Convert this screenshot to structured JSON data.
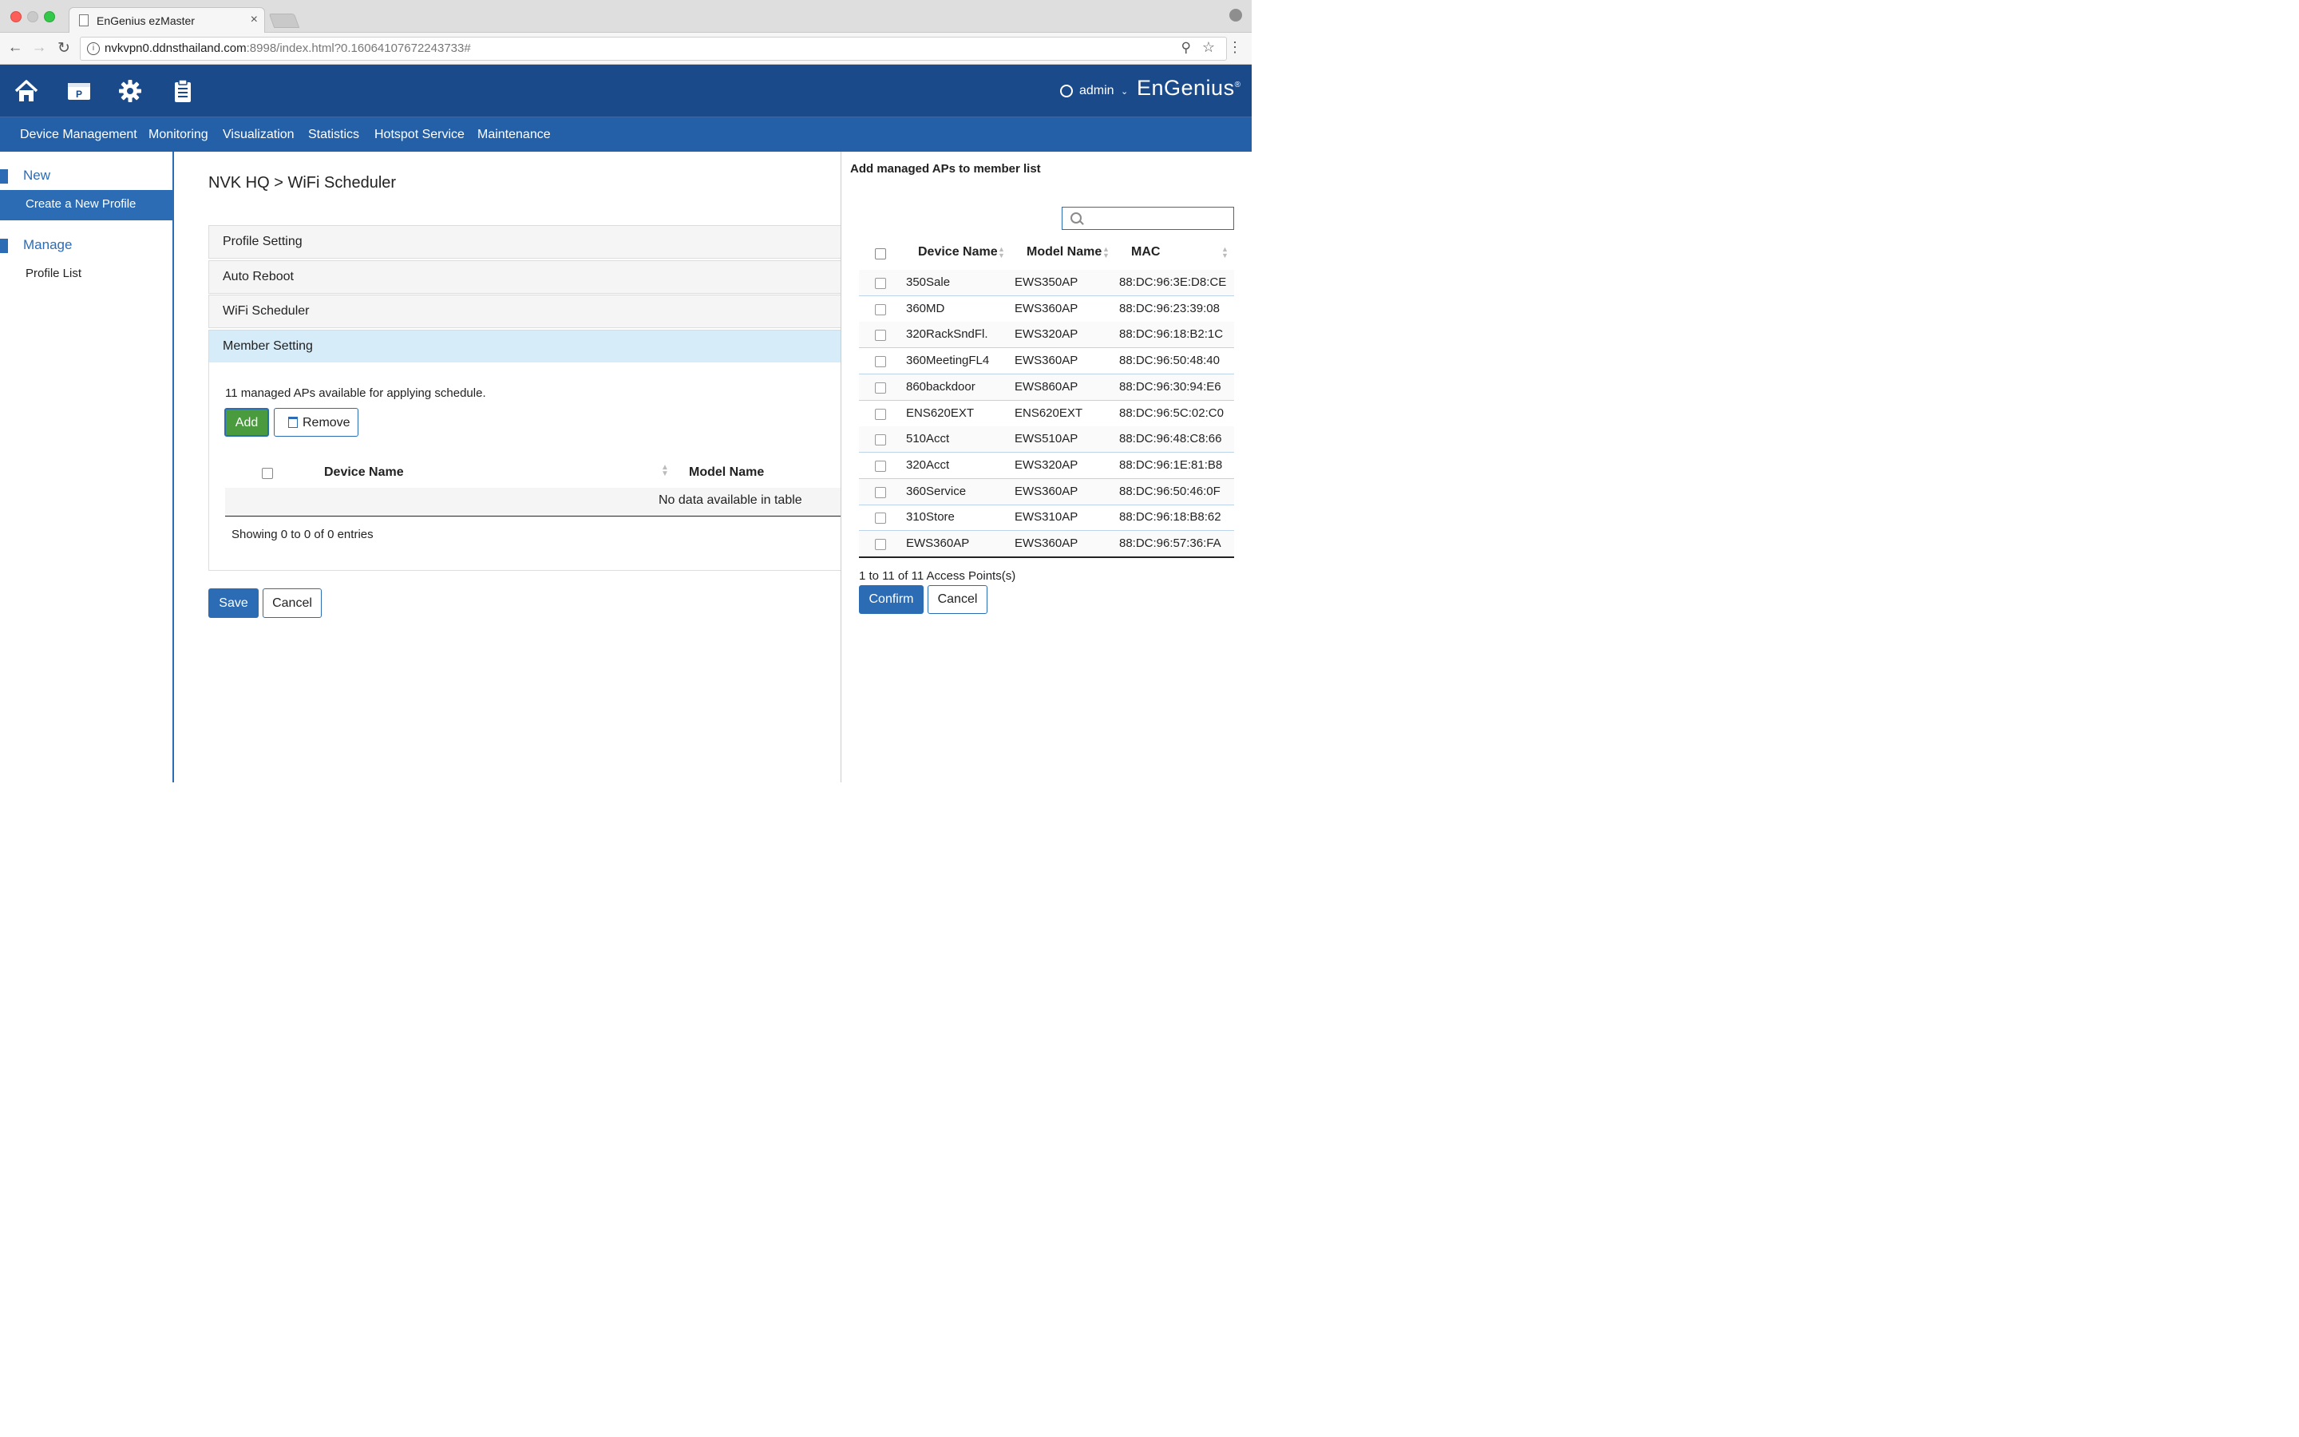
{
  "browser": {
    "tab_title": "EnGenius ezMaster",
    "tab_close": "×",
    "url_host": "nvkvpn0.ddnsthailand.com",
    "url_rest": ":8998/index.html?0.16064107672243733#"
  },
  "header": {
    "user": "admin",
    "brand": "EnGenius",
    "brand_mark": "®"
  },
  "nav": [
    "Device Management",
    "Monitoring",
    "Visualization",
    "Statistics",
    "Hotspot Service",
    "Maintenance"
  ],
  "sidebar": {
    "new_label": "New",
    "create_label": "Create a New Profile",
    "manage_label": "Manage",
    "profile_list_label": "Profile List"
  },
  "main": {
    "breadcrumb": "NVK HQ > WiFi Scheduler",
    "accordion": [
      "Profile Setting",
      "Auto Reboot",
      "WiFi Scheduler",
      "Member Setting"
    ],
    "available_text": "11 managed APs available for applying schedule.",
    "add_label": "Add",
    "remove_label": "Remove",
    "col_device": "Device Name",
    "col_model": "Model Name",
    "empty_text": "No data available in table",
    "showing_text": "Showing 0 to 0 of 0 entries",
    "save_label": "Save",
    "cancel_label": "Cancel"
  },
  "panel": {
    "title": "Add managed APs to member list",
    "search_placeholder": "",
    "col_device": "Device Name",
    "col_model": "Model Name",
    "col_mac": "MAC",
    "rows": [
      {
        "name": "350Sale",
        "model": "EWS350AP",
        "mac": "88:DC:96:3E:D8:CE"
      },
      {
        "name": "360MD",
        "model": "EWS360AP",
        "mac": "88:DC:96:23:39:08"
      },
      {
        "name": "320RackSndFl.",
        "model": "EWS320AP",
        "mac": "88:DC:96:18:B2:1C"
      },
      {
        "name": "360MeetingFL4",
        "model": "EWS360AP",
        "mac": "88:DC:96:50:48:40"
      },
      {
        "name": "860backdoor",
        "model": "EWS860AP",
        "mac": "88:DC:96:30:94:E6"
      },
      {
        "name": "ENS620EXT",
        "model": "ENS620EXT",
        "mac": "88:DC:96:5C:02:C0"
      },
      {
        "name": "510Acct",
        "model": "EWS510AP",
        "mac": "88:DC:96:48:C8:66"
      },
      {
        "name": "320Acct",
        "model": "EWS320AP",
        "mac": "88:DC:96:1E:81:B8"
      },
      {
        "name": "360Service",
        "model": "EWS360AP",
        "mac": "88:DC:96:50:46:0F"
      },
      {
        "name": "310Store",
        "model": "EWS310AP",
        "mac": "88:DC:96:18:B8:62"
      },
      {
        "name": "EWS360AP",
        "model": "EWS360AP",
        "mac": "88:DC:96:57:36:FA"
      }
    ],
    "count_text": "1 to 11 of 11 Access Points(s)",
    "confirm_label": "Confirm",
    "cancel_label": "Cancel"
  }
}
